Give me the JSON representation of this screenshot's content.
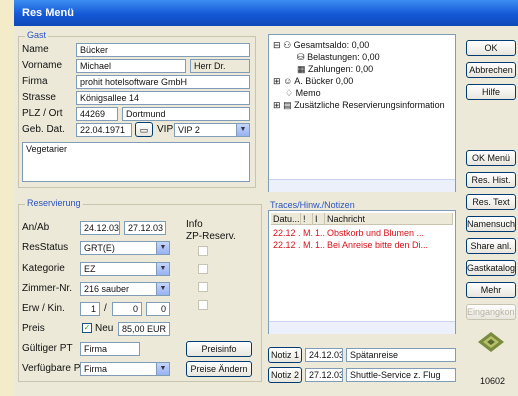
{
  "window": {
    "title": "Res Menü"
  },
  "guest": {
    "group_label": "Gast",
    "name_label": "Name",
    "name_value": "Bücker",
    "firstname_label": "Vorname",
    "firstname_value": "Michael",
    "salutation_value": "Herr Dr.",
    "company_label": "Firma",
    "company_value": "prohit hotelsoftware GmbH",
    "street_label": "Strasse",
    "street_value": "Königsallee 14",
    "zip_label": "PLZ / Ort",
    "zip_value": "44269",
    "city_value": "Dortmund",
    "birth_label": "Geb. Dat.",
    "birth_value": "22.04.1971",
    "vip_label": "VIP",
    "vip_value": "VIP 2",
    "notes_value": "Vegetarier"
  },
  "reservation": {
    "group_label": "Reservierung",
    "arrival_label": "An/Ab",
    "arrival_value": "24.12.03",
    "departure_value": "27.12.03",
    "info_label": "Info",
    "rooms_label": "ZP-Reserv.",
    "status_label": "ResStatus",
    "status_value": "GRT(E)",
    "category_label": "Kategorie",
    "category_value": "EZ",
    "room_label": "Zimmer-Nr.",
    "room_value": "216 sauber",
    "persons_label": "Erw / Kin.",
    "adults_value": "1",
    "children_value": "0",
    "extra_value": "0",
    "price_label": "Preis",
    "price_new_label": "Neu",
    "price_value": "85,00 EUR",
    "valid_label": "Gültiger PT",
    "valid_value": "Firma",
    "payment_label": "Verfügbare PT",
    "payment_value": "Firma",
    "rates_button": "Preisinfo",
    "rates_change_button": "Preise Ändern"
  },
  "tree": {
    "items": [
      {
        "label": "Gesamtsaldo: 0,00"
      },
      {
        "label": "Belastungen: 0,00"
      },
      {
        "label": "Zahlungen: 0,00"
      },
      {
        "label": "A. Bücker 0,00"
      },
      {
        "label": "Memo"
      },
      {
        "label": "Zusätzliche Reservierungsinformation"
      }
    ]
  },
  "traces": {
    "group_label": "Traces/Hinw./Notizen",
    "columns": [
      "Datu...",
      "!",
      "I",
      "Nachricht"
    ],
    "rows": [
      {
        "date": "22.12 ...",
        "c1": "M...",
        "c2": "1...",
        "msg": "Obstkorb und Blumen ..."
      },
      {
        "date": "22.12 ...",
        "c1": "M...",
        "c2": "1...",
        "msg": "Bei Anreise bitte den Di..."
      }
    ]
  },
  "notes": [
    {
      "button": "Notiz 1",
      "date": "24.12.03",
      "text": "Spätanreise"
    },
    {
      "button": "Notiz 2",
      "date": "27.12.03",
      "text": "Shuttle-Service z. Flug"
    }
  ],
  "right_buttons": {
    "ok": "OK",
    "cancel": "Abbrechen",
    "help": "Hilfe",
    "ok_menu": "OK Menü",
    "res_hist": "Res. Hist.",
    "res_text": "Res. Text",
    "names": "Namensuche",
    "share": "Share anl.",
    "guestlog": "Gastkatalog",
    "more": "Mehr",
    "disabled": "Eingangkon..."
  },
  "footer": {
    "number": "10602"
  }
}
